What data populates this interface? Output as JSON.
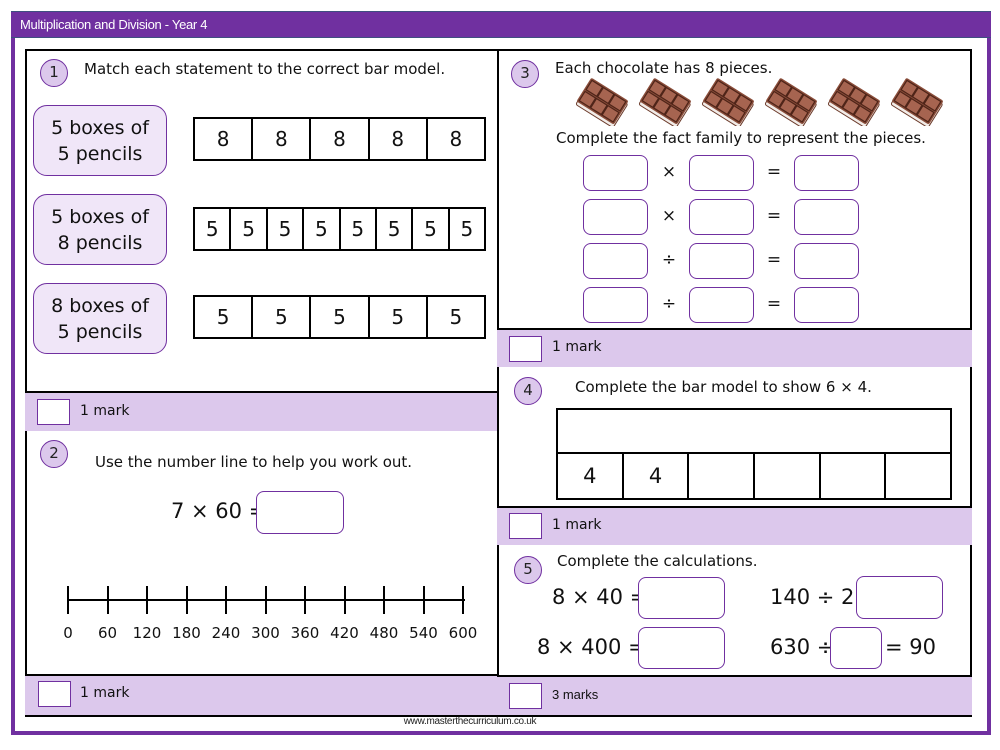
{
  "header": {
    "title": "Multiplication and Division - Year 4"
  },
  "footer": {
    "url": "www.masterthecurriculum.co.uk"
  },
  "colors": {
    "brand_purple": "#7030a0",
    "mark_bar": "#dcc8ec",
    "statement_fill": "#f0e6f8"
  },
  "q1": {
    "number": "1",
    "instruction": "Match each statement to the correct bar model.",
    "statements": [
      {
        "line1": "5 boxes of",
        "line2": "5 pencils"
      },
      {
        "line1": "5 boxes of",
        "line2": "8 pencils"
      },
      {
        "line1": "8 boxes of",
        "line2": "5 pencils"
      }
    ],
    "bar_models": [
      [
        "8",
        "8",
        "8",
        "8",
        "8"
      ],
      [
        "5",
        "5",
        "5",
        "5",
        "5",
        "5",
        "5",
        "5"
      ],
      [
        "5",
        "5",
        "5",
        "5",
        "5"
      ]
    ],
    "marks": "1 mark"
  },
  "q2": {
    "number": "2",
    "instruction": "Use the number line to help you work out.",
    "equation": "7 × 60 =",
    "number_line": [
      "0",
      "60",
      "120",
      "180",
      "240",
      "300",
      "360",
      "420",
      "480",
      "540",
      "600"
    ],
    "marks": "1 mark"
  },
  "q3": {
    "number": "3",
    "instruction": "Each chocolate has 8 pieces.",
    "chocolate_count": 6,
    "subinstruction": "Complete the fact family to represent the pieces.",
    "fact_family": [
      {
        "op": "×",
        "eq": "="
      },
      {
        "op": "×",
        "eq": "="
      },
      {
        "op": "÷",
        "eq": "="
      },
      {
        "op": "÷",
        "eq": "="
      }
    ],
    "marks": "1 mark"
  },
  "q4": {
    "number": "4",
    "instruction": "Complete the bar model to show 6 × 4.",
    "bar_cells": [
      "4",
      "4",
      "",
      "",
      "",
      ""
    ],
    "marks": "1 mark"
  },
  "q5": {
    "number": "5",
    "instruction": "Complete the calculations.",
    "calc1": "8 × 40 =",
    "calc2": "140 ÷ 2 =",
    "calc3": "8 × 400 =",
    "calc4_left": "630 ÷",
    "calc4_right": "= 90",
    "marks": "3 marks"
  }
}
